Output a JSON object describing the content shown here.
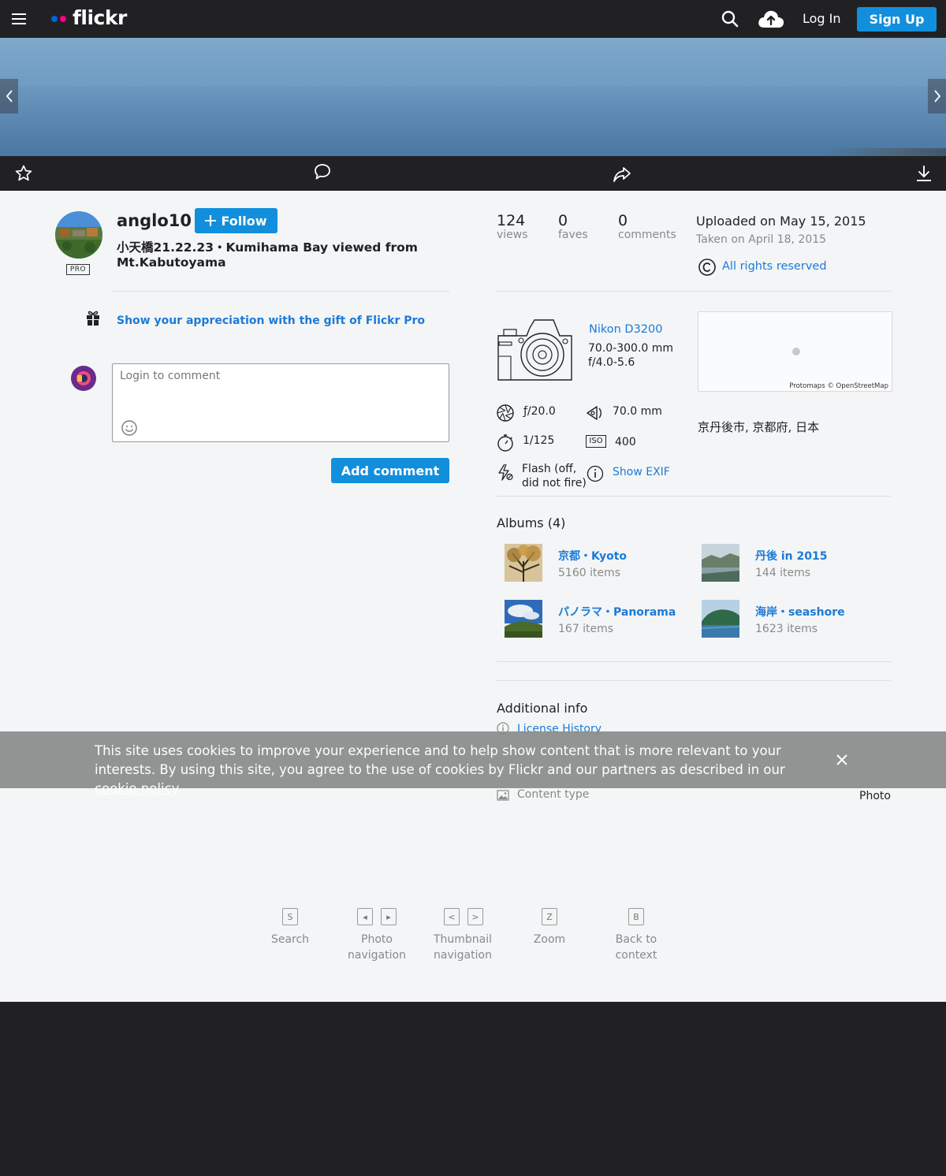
{
  "topbar": {
    "logo_text": "flickr",
    "login_label": "Log In",
    "signup_label": "Sign Up"
  },
  "owner": {
    "username": "anglo10",
    "pro_badge": "PRO",
    "follow_label": "Follow"
  },
  "photo": {
    "title": "小天橋21.22.23・Kumihama Bay viewed from Mt.Kabutoyama"
  },
  "gift": {
    "label": "Show your appreciation with the gift of Flickr Pro"
  },
  "comment": {
    "placeholder": "Login to comment",
    "add_label": "Add comment"
  },
  "stats": {
    "views": {
      "value": "124",
      "label": "views"
    },
    "faves": {
      "value": "0",
      "label": "faves"
    },
    "comments": {
      "value": "0",
      "label": "comments"
    },
    "uploaded": "Uploaded on May 15, 2015",
    "taken": "Taken on April 18, 2015",
    "rights": "All rights reserved"
  },
  "camera": {
    "model": "Nikon D3200",
    "lens": "70.0-300.0 mm",
    "aperture_range": "f/4.0-5.6"
  },
  "exif": {
    "aperture": "ƒ/20.0",
    "focal_length": "70.0 mm",
    "shutter": "1/125",
    "iso": "400",
    "iso_icon_label": "ISO",
    "flash_line1": "Flash (off,",
    "flash_line2": "did not fire)",
    "show_exif": "Show EXIF"
  },
  "map": {
    "credit": "Protomaps © OpenStreetMap"
  },
  "location": "京丹後市, 京都府, 日本",
  "albums": {
    "heading": "Albums (4)",
    "items": [
      {
        "title": "京都・Kyoto",
        "count": "5160 items"
      },
      {
        "title": "丹後 in 2015",
        "count": "144 items"
      },
      {
        "title": "パノラマ・Panorama",
        "count": "167 items"
      },
      {
        "title": "海岸・seashore",
        "count": "1623 items"
      }
    ]
  },
  "additional": {
    "heading": "Additional info",
    "license_history": "License History",
    "content_type_label": "Content type",
    "content_type_value": "Photo"
  },
  "cookie": {
    "text": "This site uses cookies to improve your experience and to help show content that is more relevant to your interests. By using this site, you agree to the use of cookies by Flickr and our partners as described in our ",
    "link": "cookie policy",
    "end": "."
  },
  "shortcuts": [
    {
      "keys": [
        "S"
      ],
      "label_line1": "Search",
      "label_line2": ""
    },
    {
      "keys": [
        "◂",
        "▸"
      ],
      "label_line1": "Photo",
      "label_line2": "navigation"
    },
    {
      "keys": [
        "<",
        ">"
      ],
      "label_line1": "Thumbnail",
      "label_line2": "navigation"
    },
    {
      "keys": [
        "Z"
      ],
      "label_line1": "Zoom",
      "label_line2": ""
    },
    {
      "keys": [
        "B"
      ],
      "label_line1": "Back to",
      "label_line2": "context"
    }
  ],
  "colors": {
    "brand_blue": "#128fdc",
    "link_blue": "#1c7ad8",
    "logo_blue": "#0063dc",
    "logo_pink": "#ff0084",
    "dark_bg": "#212124",
    "content_bg": "#f3f5f6"
  }
}
